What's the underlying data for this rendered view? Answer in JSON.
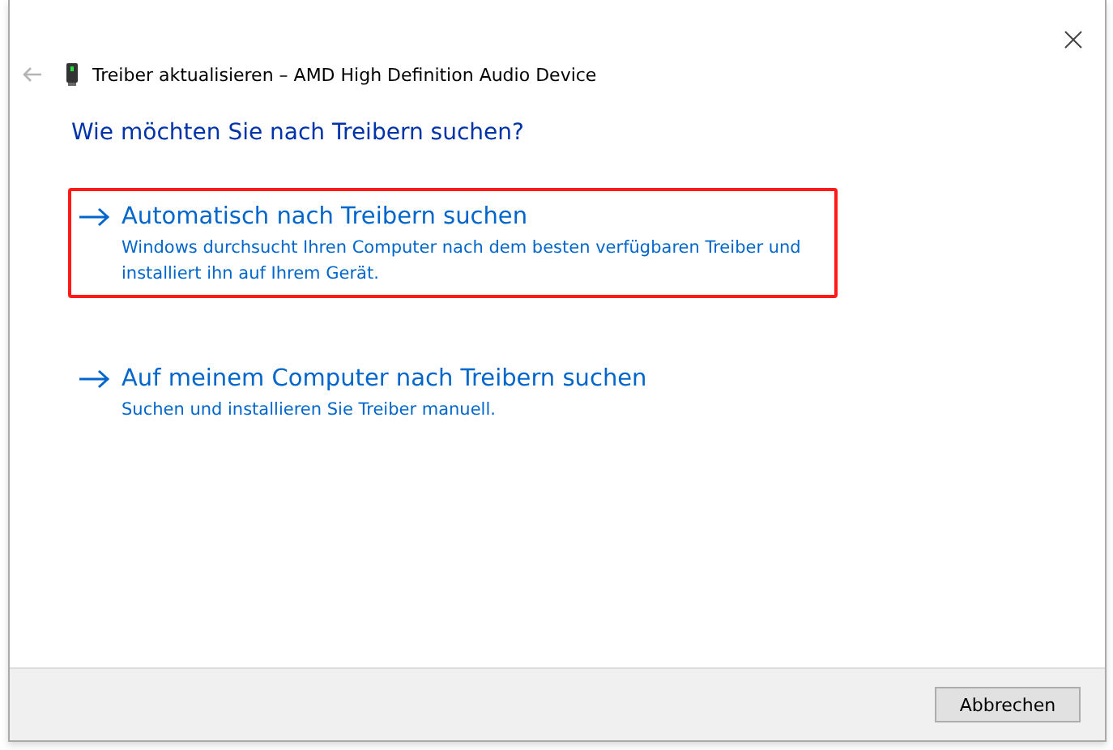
{
  "window": {
    "title": "Treiber aktualisieren – AMD High Definition Audio Device"
  },
  "heading": "Wie möchten Sie nach Treibern suchen?",
  "options": [
    {
      "title": "Automatisch nach Treibern suchen",
      "description": "Windows durchsucht Ihren Computer nach dem besten verfügbaren Treiber und installiert ihn auf Ihrem Gerät.",
      "highlighted": true
    },
    {
      "title": "Auf meinem Computer nach Treibern suchen",
      "description": "Suchen und installieren Sie Treiber manuell.",
      "highlighted": false
    }
  ],
  "buttons": [
    "Abbrechen"
  ]
}
